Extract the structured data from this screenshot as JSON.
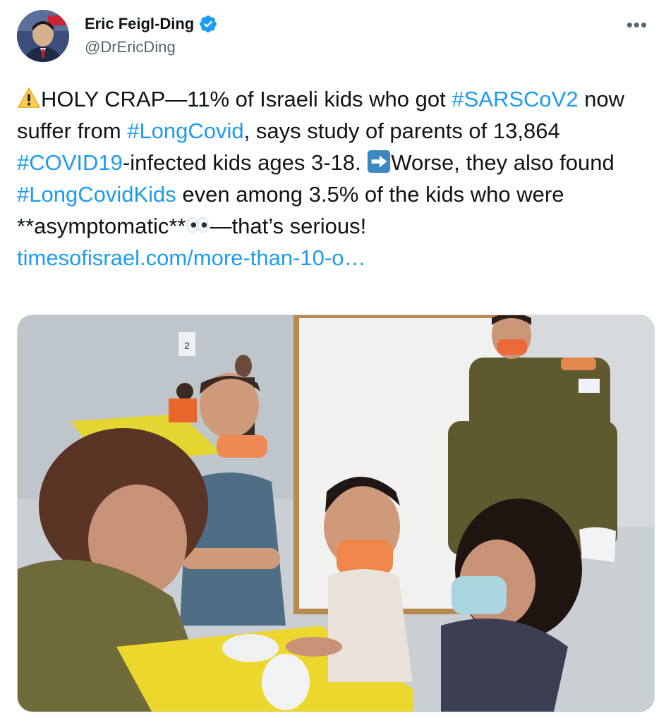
{
  "author": {
    "display_name": "Eric Feigl-Ding",
    "handle": "@DrEricDing"
  },
  "more_label": "•••",
  "tweet": {
    "part1": "HOLY CRAP—11% of Israeli kids who got ",
    "hashtag1": "#SARSCoV2",
    "part2": " now suffer from ",
    "hashtag2": "#LongCovid",
    "part3": ", says study of parents of 13,864 ",
    "hashtag3": "#COVID19",
    "part4": "-infected kids ages 3-18. ",
    "part5": "Worse, they also found ",
    "hashtag4": "#LongCovidKids",
    "part6": " even among 3.5% of the kids who were **asymptomatic**",
    "part7": "—that’s serious!",
    "link": "timesofisrael.com/more-than-10-o…"
  },
  "media": {
    "wall_number": "2"
  },
  "colors": {
    "link": "#1d9bf0",
    "text": "#0f1419",
    "muted": "#536471",
    "verified": "#1d9bf0"
  },
  "icons": [
    "warning-emoji-icon",
    "right-arrow-emoji-icon",
    "eyes-emoji-icon",
    "verified-badge-icon",
    "more-options-icon"
  ]
}
